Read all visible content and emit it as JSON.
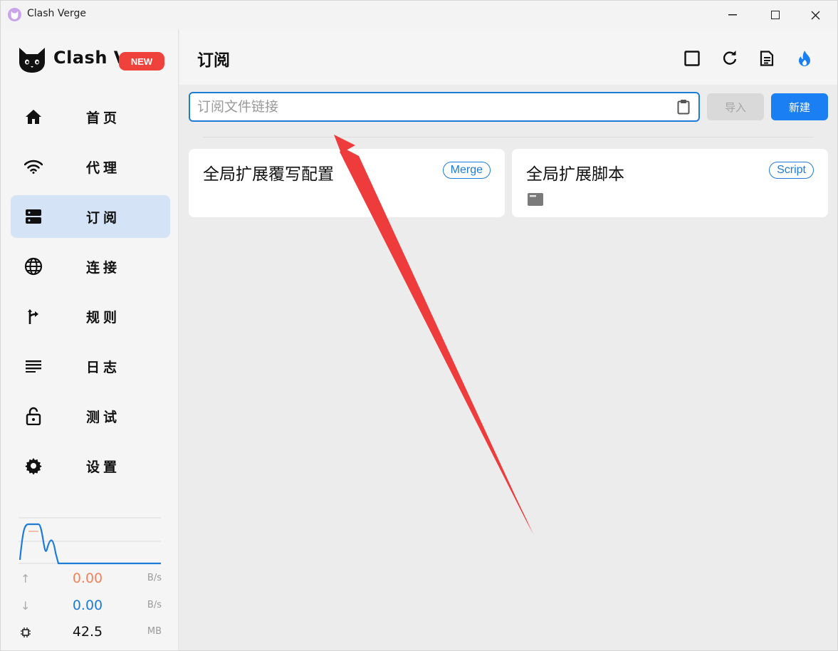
{
  "window": {
    "title": "Clash Verge",
    "icon": "cat-app-icon",
    "controls": [
      "minimize",
      "maximize",
      "close"
    ]
  },
  "sidebar": {
    "logo_text": "Clash V",
    "new_badge": "NEW",
    "items": [
      {
        "label": "首页",
        "icon": "home-icon",
        "active": false
      },
      {
        "label": "代理",
        "icon": "wifi-icon",
        "active": false
      },
      {
        "label": "订阅",
        "icon": "storage-icon",
        "active": true
      },
      {
        "label": "连接",
        "icon": "globe-icon",
        "active": false
      },
      {
        "label": "规则",
        "icon": "fork-arrow-icon",
        "active": false
      },
      {
        "label": "日志",
        "icon": "list-lines-icon",
        "active": false
      },
      {
        "label": "测试",
        "icon": "unlock-icon",
        "active": false
      },
      {
        "label": "设置",
        "icon": "gear-icon",
        "active": false
      }
    ],
    "traffic": {
      "upload": {
        "value": "0.00",
        "unit": "B/s",
        "color": "#f0845a"
      },
      "download": {
        "value": "0.00",
        "unit": "B/s",
        "color": "#1e7bd8"
      },
      "memory": {
        "value": "42.5",
        "unit": "MB"
      }
    }
  },
  "main": {
    "title": "订阅",
    "header_buttons": [
      "square-icon",
      "refresh-icon",
      "document-icon",
      "fire-icon"
    ],
    "search": {
      "placeholder": "订阅文件链接",
      "value": ""
    },
    "import_label": "导入",
    "new_label": "新建",
    "cards": [
      {
        "title": "全局扩展覆写配置",
        "tag": "Merge"
      },
      {
        "title": "全局扩展脚本",
        "tag": "Script"
      }
    ]
  },
  "colors": {
    "accent": "#1e7bd8",
    "badge": "#f0423c",
    "annotation_arrow": "#ee3b3b",
    "active_nav": "#d4e3f5"
  }
}
